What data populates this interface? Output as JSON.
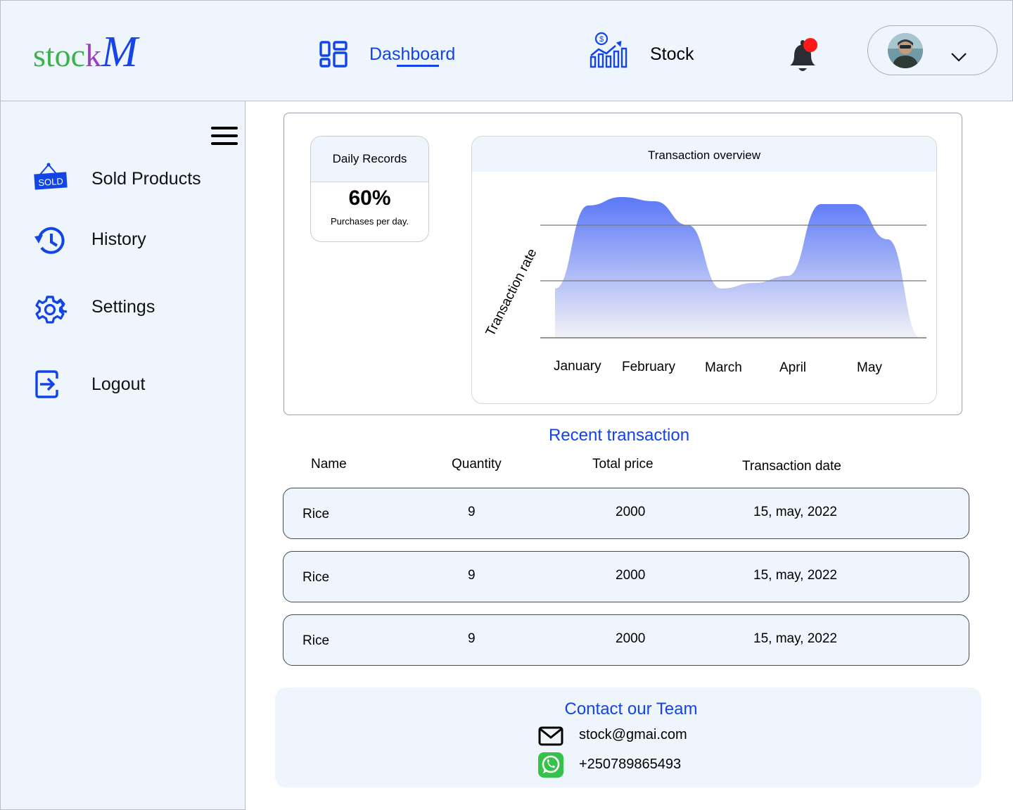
{
  "header": {
    "logo": {
      "part1": "stoc",
      "part2": "k",
      "part3": "M"
    },
    "nav": [
      {
        "label": "Dashboard",
        "icon": "dashboard-icon",
        "active": true
      },
      {
        "label": "Stock",
        "icon": "stock-chart-icon",
        "active": false
      }
    ],
    "notification": {
      "icon": "bell-icon",
      "has_badge": true,
      "badge_color": "#ff1a1a"
    },
    "profile": {
      "avatar": "avatar",
      "dropdown_icon": "chevron-down-icon"
    }
  },
  "sidebar": {
    "menu_icon": "hamburger-menu-icon",
    "items": [
      {
        "label": "Sold Products",
        "icon": "sold-tag-icon"
      },
      {
        "label": "History",
        "icon": "history-icon"
      },
      {
        "label": "Settings",
        "icon": "gear-icon"
      },
      {
        "label": "Logout",
        "icon": "logout-icon"
      }
    ]
  },
  "daily_records": {
    "title": "Daily Records",
    "value": "60%",
    "subtitle": "Purchases per day."
  },
  "chart_data": {
    "type": "area",
    "title": "Transaction overview",
    "xlabel": "",
    "ylabel": "Transaction rate",
    "categories": [
      "January",
      "February",
      "March",
      "April",
      "May"
    ],
    "grid": true,
    "series": [
      {
        "values": [
          0.35,
          0.94,
          1.0,
          0.97,
          0.8,
          0.35,
          0.39,
          0.44,
          0.95,
          0.95,
          0.7,
          0.0
        ]
      }
    ]
  },
  "transactions": {
    "title": "Recent transaction",
    "columns": [
      "Name",
      "Quantity",
      "Total price",
      "Transaction date"
    ],
    "rows": [
      [
        "Rice",
        "9",
        "2000",
        "15, may, 2022"
      ],
      [
        "Rice",
        "9",
        "2000",
        "15, may, 2022"
      ],
      [
        "Rice",
        "9",
        "2000",
        "15, may, 2022"
      ]
    ]
  },
  "contact": {
    "title": "Contact our Team",
    "email": "stock@gmai.com",
    "email_icon": "mail-icon",
    "phone": "+250789865493",
    "phone_icon": "whatsapp-icon"
  },
  "colors": {
    "accent": "#1244e6",
    "panel_bg": "#eff5fd",
    "chart_fill_top": "#5b78f7",
    "chart_fill_bottom": "#f2f2f6",
    "badge": "#ff1a1a",
    "whatsapp": "#36c24a"
  }
}
